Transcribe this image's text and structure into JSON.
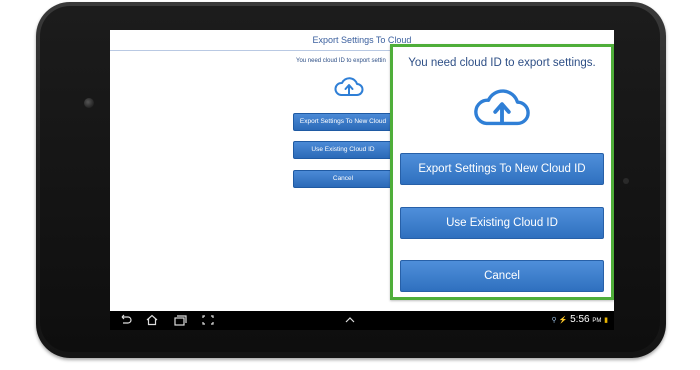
{
  "app": {
    "title": "Export Settings To Cloud",
    "message": "You need cloud ID to export settings.",
    "message_truncated": "You need cloud ID to export settin",
    "buttons": {
      "export_new": "Export Settings To New Cloud ID",
      "export_new_truncated": "Export Settings To New Cloud",
      "use_existing": "Use Existing Cloud ID",
      "cancel": "Cancel"
    }
  },
  "system_bar": {
    "time": "5:56",
    "ampm": "PM"
  },
  "colors": {
    "accent": "#2f70bf",
    "callout_border": "#4fae3a",
    "text_blue": "#2e4f86"
  },
  "icons": [
    "cloud-upload-icon",
    "back-icon",
    "home-icon",
    "recent-apps-icon",
    "screenshot-icon",
    "chevron-up-icon",
    "usb-icon",
    "battery-icon"
  ]
}
